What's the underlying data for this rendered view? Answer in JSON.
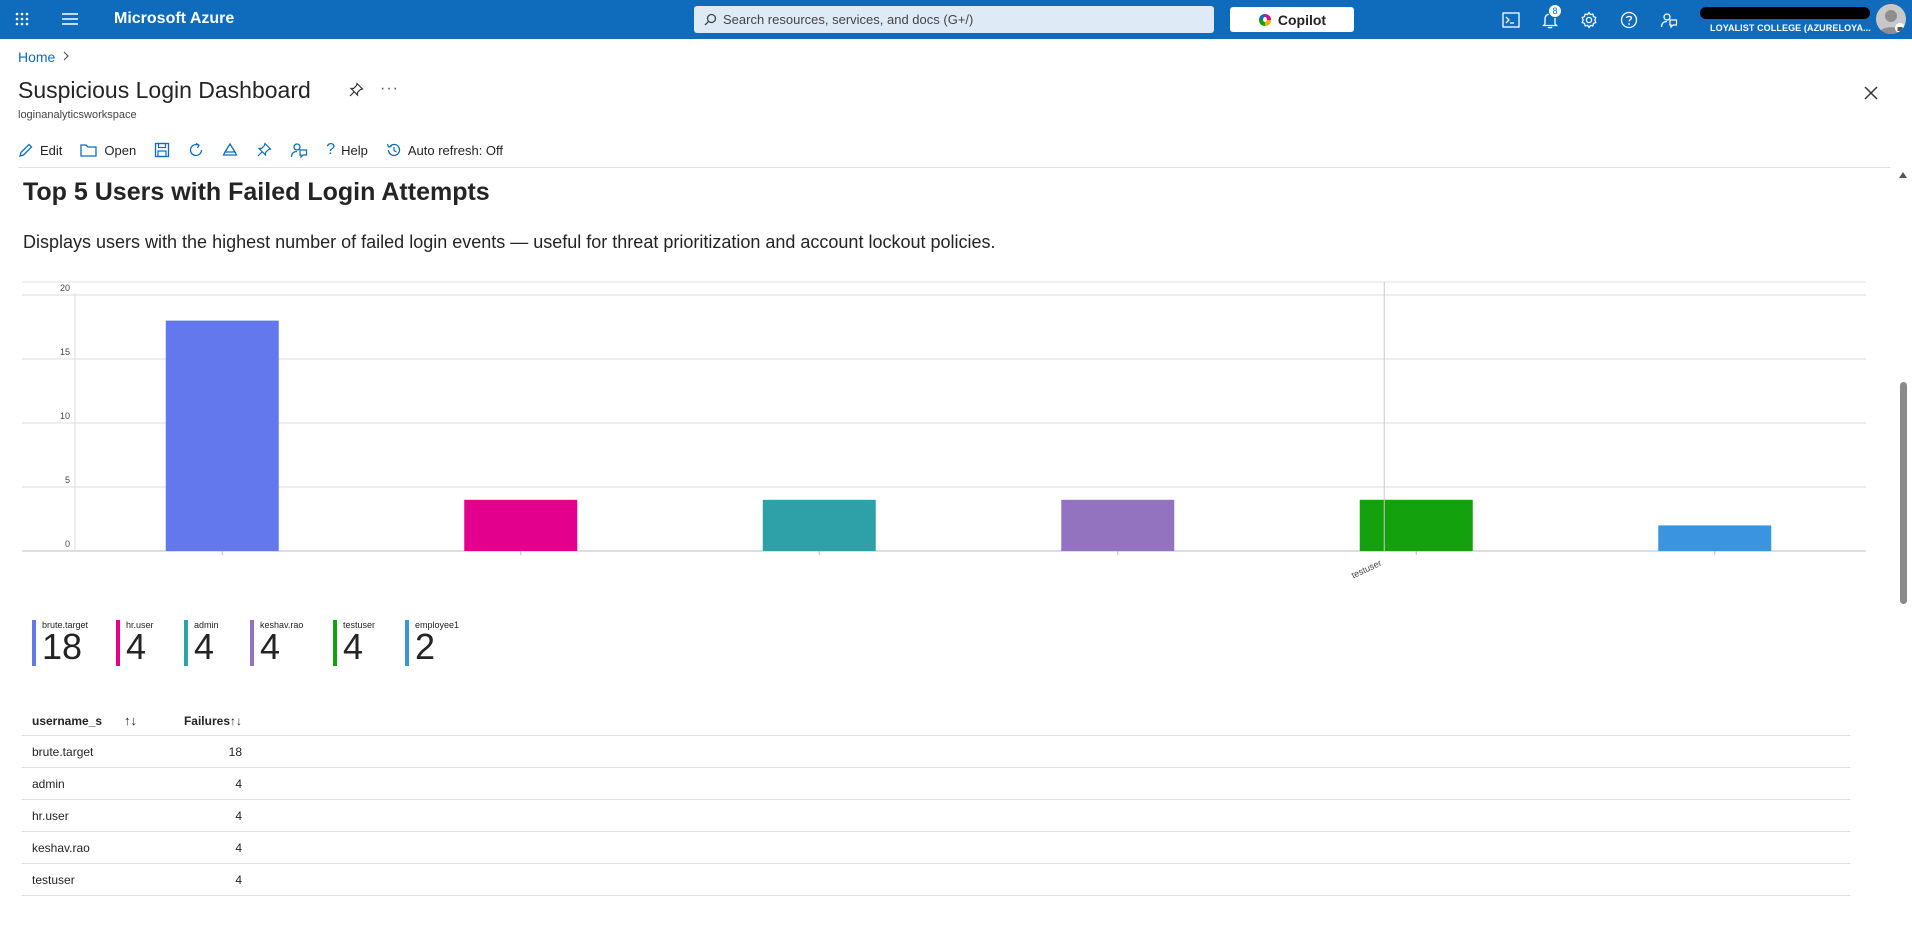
{
  "topbar": {
    "brand": "Microsoft Azure",
    "search_placeholder": "Search resources, services, and docs (G+/)",
    "copilot_label": "Copilot",
    "notification_count": "8",
    "account_name": "LOYALIST COLLEGE (AZURELOYA...",
    "icons": [
      "apps-grid-icon",
      "hamburger-menu-icon",
      "cloud-shell-icon",
      "bell-icon",
      "gear-icon",
      "help-icon",
      "feedback-icon"
    ]
  },
  "header": {
    "breadcrumb_home": "Home",
    "title": "Suspicious Login Dashboard",
    "subtitle": "loginanalyticsworkspace"
  },
  "toolbar": {
    "edit_label": "Edit",
    "open_label": "Open",
    "help_label": "Help",
    "auto_refresh_label": "Auto refresh: Off"
  },
  "section": {
    "title": "Top 5 Users with Failed Login Attempts",
    "description": "Displays users with the highest number of failed login events — useful for threat prioritization and account lockout policies."
  },
  "colors": {
    "azure_blue": "#0f6cbd",
    "series": [
      "#6478ee",
      "#e3008c",
      "#2ea0a7",
      "#9373c0",
      "#13a10e",
      "#3b94df"
    ]
  },
  "chart_data": {
    "type": "bar",
    "categories": [
      "brute.target",
      "hr.user",
      "admin",
      "keshav.rao",
      "testuser",
      "employee1"
    ],
    "values": [
      18,
      4,
      4,
      4,
      4,
      2
    ],
    "visible_x_tick_labels": [
      "testuser"
    ],
    "y_ticks": [
      "20",
      "15",
      "10",
      "5",
      "0"
    ],
    "ylim": [
      0,
      20
    ],
    "grid": true,
    "title": "",
    "xlabel": "",
    "ylabel": ""
  },
  "tiles": [
    {
      "label": "brute.target",
      "value": "18"
    },
    {
      "label": "hr.user",
      "value": "4"
    },
    {
      "label": "admin",
      "value": "4"
    },
    {
      "label": "keshav.rao",
      "value": "4"
    },
    {
      "label": "testuser",
      "value": "4"
    },
    {
      "label": "employee1",
      "value": "2"
    }
  ],
  "table": {
    "columns": [
      "username_s",
      "Failures"
    ],
    "sort_glyph": "↑↓",
    "rows": [
      {
        "username": "brute.target",
        "failures": "18"
      },
      {
        "username": "admin",
        "failures": "4"
      },
      {
        "username": "hr.user",
        "failures": "4"
      },
      {
        "username": "keshav.rao",
        "failures": "4"
      },
      {
        "username": "testuser",
        "failures": "4"
      }
    ]
  }
}
